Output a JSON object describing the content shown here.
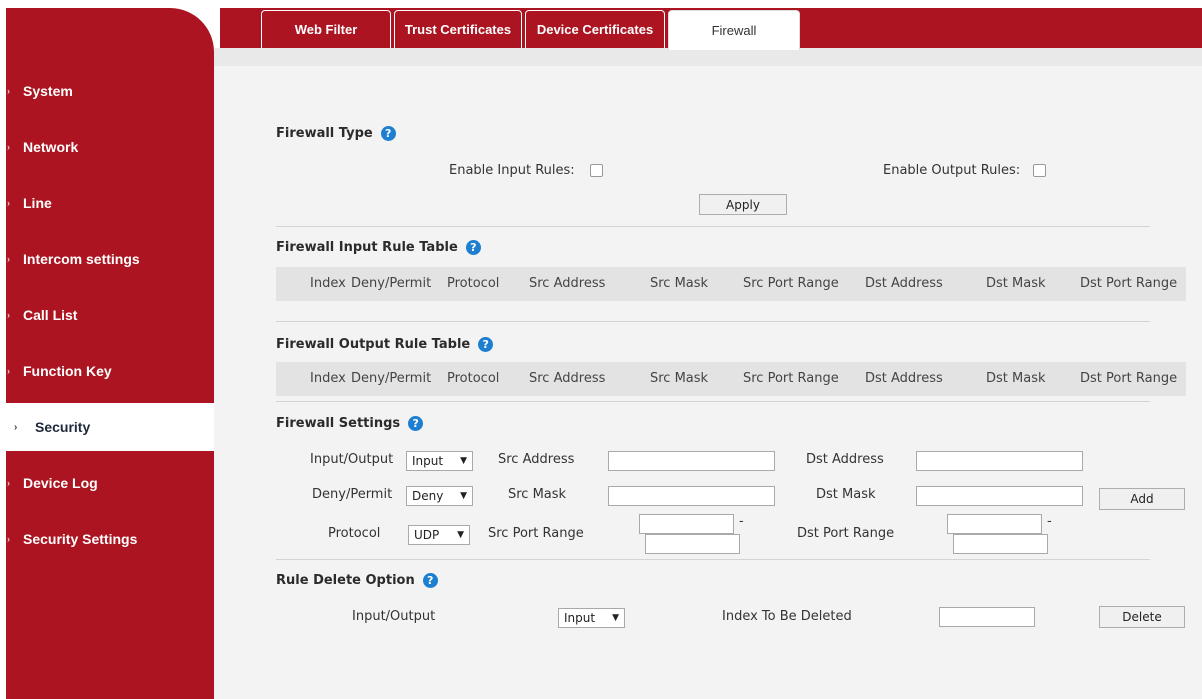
{
  "sidebar": {
    "items": [
      {
        "label": "System"
      },
      {
        "label": "Network"
      },
      {
        "label": "Line"
      },
      {
        "label": "Intercom settings"
      },
      {
        "label": "Call List"
      },
      {
        "label": "Function Key"
      },
      {
        "label": "Security"
      },
      {
        "label": "Device Log"
      },
      {
        "label": "Security Settings"
      }
    ],
    "arrow": "›"
  },
  "tabs": [
    {
      "label": "Web Filter"
    },
    {
      "label": "Trust Certificates"
    },
    {
      "label": "Device Certificates"
    },
    {
      "label": "Firewall"
    }
  ],
  "firewall_type": {
    "title": "Firewall Type",
    "enable_input_label": "Enable Input Rules:",
    "enable_output_label": "Enable Output Rules:",
    "apply_label": "Apply"
  },
  "input_table": {
    "title": "Firewall Input Rule Table",
    "columns": [
      "Index",
      "Deny/Permit",
      "Protocol",
      "Src Address",
      "Src Mask",
      "Src Port Range",
      "Dst Address",
      "Dst Mask",
      "Dst Port Range"
    ]
  },
  "output_table": {
    "title": "Firewall Output Rule Table",
    "columns": [
      "Index",
      "Deny/Permit",
      "Protocol",
      "Src Address",
      "Src Mask",
      "Src Port Range",
      "Dst Address",
      "Dst Mask",
      "Dst Port Range"
    ]
  },
  "settings": {
    "title": "Firewall Settings",
    "io_label": "Input/Output",
    "io_value": "Input",
    "dp_label": "Deny/Permit",
    "dp_value": "Deny",
    "protocol_label": "Protocol",
    "protocol_value": "UDP",
    "src_address_label": "Src Address",
    "src_mask_label": "Src Mask",
    "src_port_label": "Src Port Range",
    "dst_address_label": "Dst Address",
    "dst_mask_label": "Dst Mask",
    "dst_port_label": "Dst Port Range",
    "dash": "-",
    "add_label": "Add"
  },
  "delete_option": {
    "title": "Rule Delete Option",
    "io_label": "Input/Output",
    "io_value": "Input",
    "index_label": "Index To Be Deleted",
    "delete_label": "Delete"
  },
  "icons": {
    "help": "?",
    "caret": "▼"
  },
  "colors": {
    "brand_red": "#ab1420",
    "help_blue": "#1e7fd0"
  }
}
